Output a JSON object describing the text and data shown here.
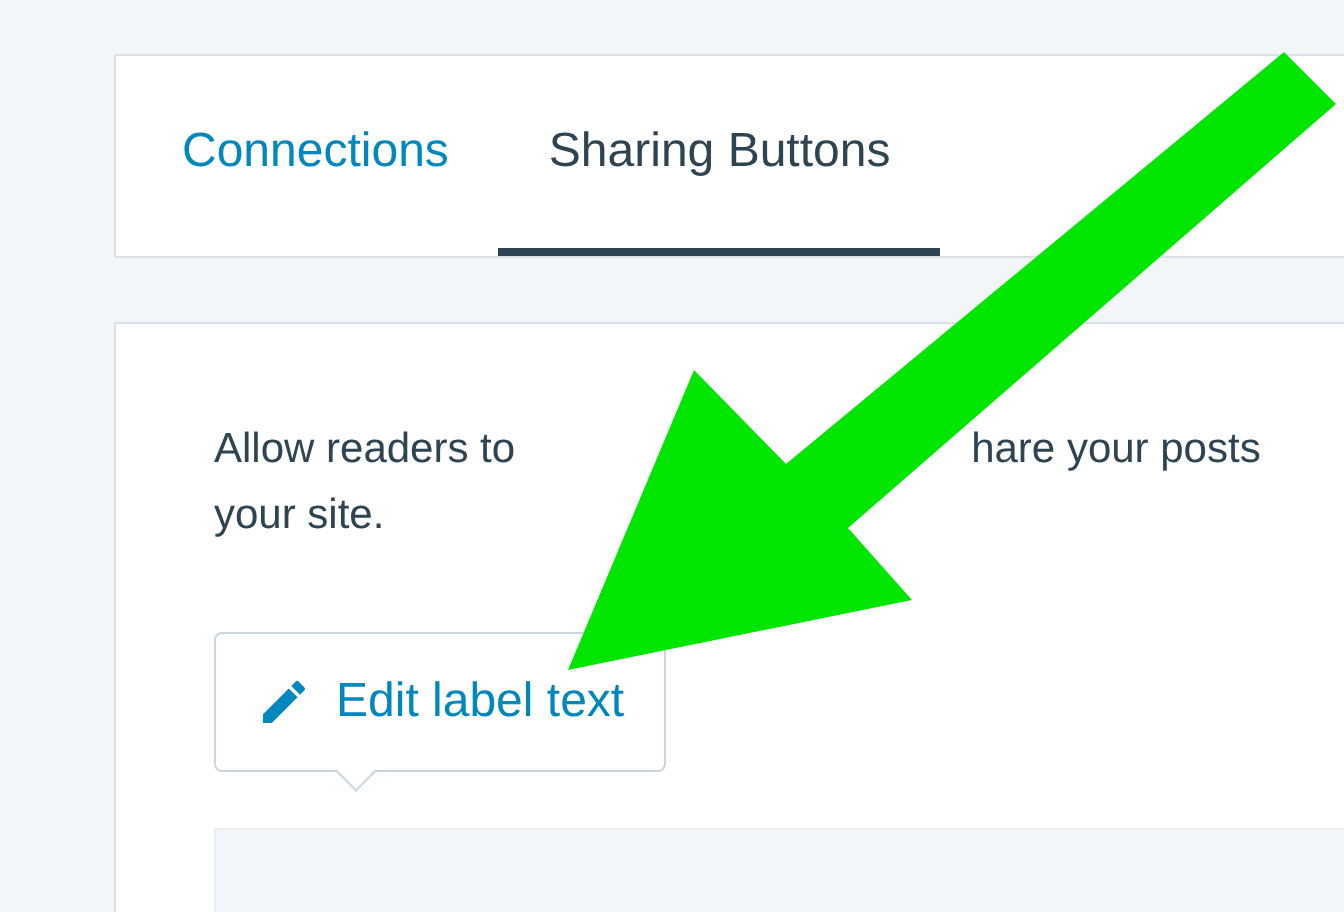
{
  "tabs": [
    {
      "label": "Connections",
      "selected": false
    },
    {
      "label": "Sharing Buttons",
      "selected": true
    }
  ],
  "description": {
    "line_1_start": "Allow readers to",
    "line_1_end": "hare your posts",
    "line_2": "your site."
  },
  "edit_button": {
    "label": "Edit label text"
  }
}
